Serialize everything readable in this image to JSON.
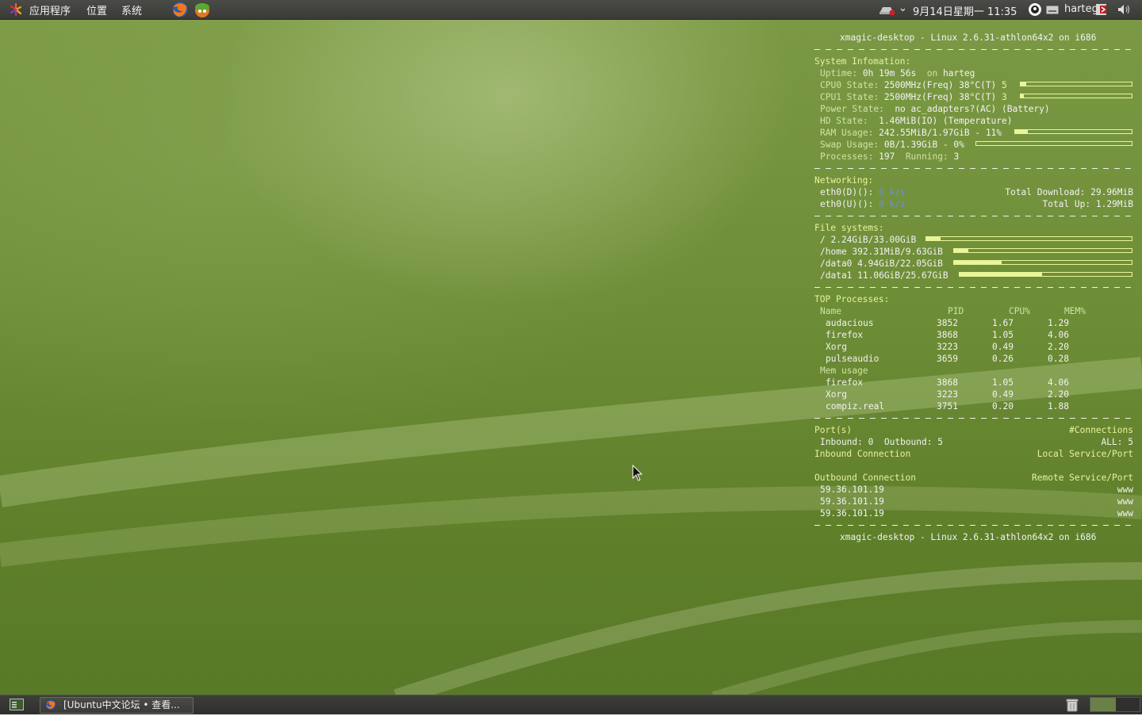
{
  "top_panel": {
    "menus": [
      "应用程序",
      "位置",
      "系统"
    ],
    "clock": "9月14日星期一 11:35",
    "user": "harteg"
  },
  "bottom_panel": {
    "task": "[Ubuntu中文论坛 • 查看..."
  },
  "conky": {
    "header": "xmagic-desktop - Linux 2.6.31-athlon64x2 on i686",
    "footer": "xmagic-desktop - Linux 2.6.31-athlon64x2 on i686",
    "system": {
      "title": "System Infomation:",
      "uptime_label": "Uptime:",
      "uptime_value": "0h 19m 56s",
      "on_label": "on",
      "host": "harteg",
      "cpu0_label": "CPU0 State:",
      "cpu0_value": "2500MHz(Freq) 38°C(T)",
      "cpu0_pct": "5",
      "cpu1_label": "CPU1 State:",
      "cpu1_value": "2500MHz(Freq) 38°C(T)",
      "cpu1_pct": "3",
      "power_label": "Power State:",
      "power_value": "no ac_adapters?(AC) (Battery)",
      "hd_label": "HD State:",
      "hd_value": "1.46MiB(IO) (Temperature)",
      "ram_label": "RAM Usage:",
      "ram_value": "242.55MiB/1.97GiB - 11%",
      "swap_label": "Swap Usage:",
      "swap_value": "0B/1.39GiB - 0%",
      "proc_label": "Processes:",
      "proc_value": "197",
      "running_label": "Running:",
      "running_value": "3",
      "cpu0_level": 0.05,
      "cpu1_level": 0.03,
      "ram_level": 0.11,
      "swap_level": 0.0
    },
    "network": {
      "title": "Networking:",
      "down_label": "eth0(D)():",
      "down_speed": "0 k/s",
      "up_label": "eth0(U)():",
      "up_speed": "0 k/s",
      "total_down_label": "Total Download:",
      "total_down": "29.96MiB",
      "total_up_label": "Total Up:",
      "total_up": "1.29MiB"
    },
    "filesystems": {
      "title": "File systems:",
      "items": [
        {
          "text": "/ 2.24GiB/33.00GiB",
          "level": 0.07
        },
        {
          "text": "/home 392.31MiB/9.63GiB",
          "level": 0.08
        },
        {
          "text": "/data0 4.94GiB/22.05GiB",
          "level": 0.27
        },
        {
          "text": "/data1 11.06GiB/25.67GiB",
          "level": 0.48
        }
      ]
    },
    "top": {
      "title": "TOP Processes:",
      "headers": [
        "Name",
        "PID",
        "CPU%",
        "MEM%"
      ],
      "cpu_rows": [
        [
          "audacious",
          "3852",
          "1.67",
          "1.29"
        ],
        [
          "firefox",
          "3868",
          "1.05",
          "4.06"
        ],
        [
          "Xorg",
          "3223",
          "0.49",
          "2.20"
        ],
        [
          "pulseaudio",
          "3659",
          "0.26",
          "0.28"
        ]
      ],
      "mem_label": "Mem usage",
      "mem_rows": [
        [
          "firefox",
          "3868",
          "1.05",
          "4.06"
        ],
        [
          "Xorg",
          "3223",
          "0.49",
          "2.20"
        ],
        [
          "compiz.real",
          "3751",
          "0.20",
          "1.88"
        ]
      ]
    },
    "ports": {
      "title": "Port(s)",
      "connections_label": "#Connections",
      "inbound_label": "Inbound:",
      "inbound_value": "0",
      "outbound_label": "Outbound:",
      "outbound_value": "5",
      "all_label": "ALL:",
      "all_value": "5",
      "inbound_conn": "Inbound Connection",
      "local_service": "Local Service/Port",
      "outbound_conn": "Outbound Connection",
      "remote_service": "Remote Service/Port",
      "outbound_rows": [
        [
          "59.36.101.19",
          "www"
        ],
        [
          "59.36.101.19",
          "www"
        ],
        [
          "59.36.101.19",
          "www"
        ]
      ]
    }
  }
}
